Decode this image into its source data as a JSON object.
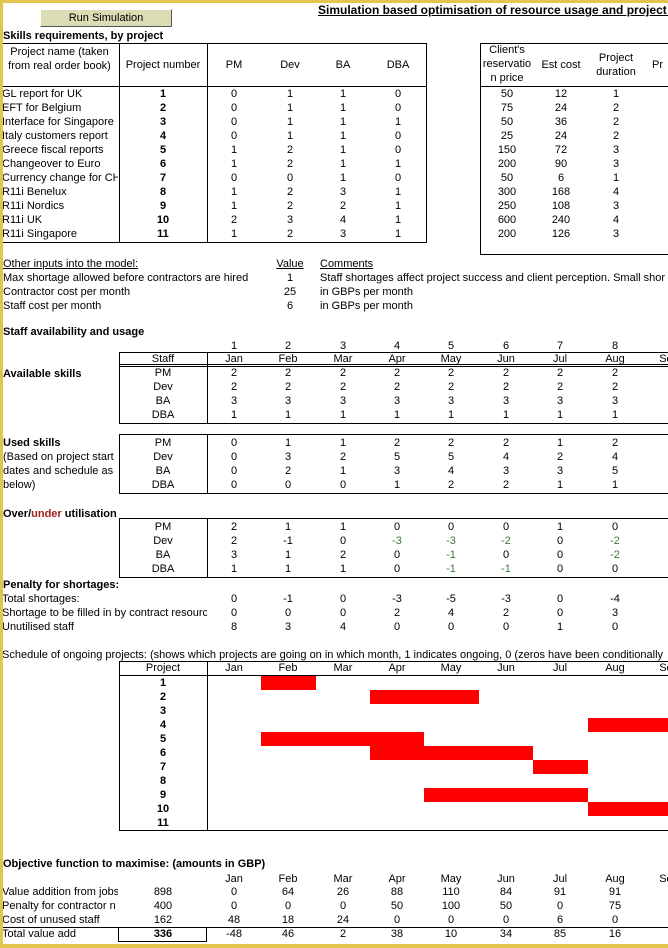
{
  "toolbar": {
    "run_label": "Run Simulation"
  },
  "title": "Simulation based optimisation of resource usage and project p",
  "skills": {
    "heading": "Skills requirements, by project",
    "headers": {
      "name": "Project name (taken from real order book)",
      "number": "Project number",
      "pm": "PM",
      "dev": "Dev",
      "ba": "BA",
      "dba": "DBA",
      "price": "Client's reservatio n price",
      "cost": "Est cost",
      "duration": "Project duration",
      "extra": "Pr"
    },
    "projects": [
      {
        "name": "GL report for UK",
        "number": "1",
        "pm": "0",
        "dev": "1",
        "ba": "1",
        "dba": "0",
        "price": "50",
        "cost": "12",
        "duration": "1"
      },
      {
        "name": "EFT for Belgium",
        "number": "2",
        "pm": "0",
        "dev": "1",
        "ba": "1",
        "dba": "0",
        "price": "75",
        "cost": "24",
        "duration": "2"
      },
      {
        "name": "Interface for Singapore",
        "number": "3",
        "pm": "0",
        "dev": "1",
        "ba": "1",
        "dba": "1",
        "price": "50",
        "cost": "36",
        "duration": "2"
      },
      {
        "name": "Italy customers report",
        "number": "4",
        "pm": "0",
        "dev": "1",
        "ba": "1",
        "dba": "0",
        "price": "25",
        "cost": "24",
        "duration": "2"
      },
      {
        "name": "Greece fiscal reports",
        "number": "5",
        "pm": "1",
        "dev": "2",
        "ba": "1",
        "dba": "0",
        "price": "150",
        "cost": "72",
        "duration": "3"
      },
      {
        "name": "Changeover to Euro",
        "number": "6",
        "pm": "1",
        "dev": "2",
        "ba": "1",
        "dba": "1",
        "price": "200",
        "cost": "90",
        "duration": "3"
      },
      {
        "name": "Currency change for CH",
        "number": "7",
        "pm": "0",
        "dev": "0",
        "ba": "1",
        "dba": "0",
        "price": "50",
        "cost": "6",
        "duration": "1"
      },
      {
        "name": "R11i Benelux",
        "number": "8",
        "pm": "1",
        "dev": "2",
        "ba": "3",
        "dba": "1",
        "price": "300",
        "cost": "168",
        "duration": "4"
      },
      {
        "name": "R11i Nordics",
        "number": "9",
        "pm": "1",
        "dev": "2",
        "ba": "2",
        "dba": "1",
        "price": "250",
        "cost": "108",
        "duration": "3"
      },
      {
        "name": "R11i UK",
        "number": "10",
        "pm": "2",
        "dev": "3",
        "ba": "4",
        "dba": "1",
        "price": "600",
        "cost": "240",
        "duration": "4"
      },
      {
        "name": "R11i Singapore",
        "number": "11",
        "pm": "1",
        "dev": "2",
        "ba": "3",
        "dba": "1",
        "price": "200",
        "cost": "126",
        "duration": "3"
      }
    ]
  },
  "inputs": {
    "heading": "Other inputs into the model:",
    "value_header": "Value",
    "comments_header": "Comments",
    "rows": [
      {
        "label": "Max shortage allowed before contractors are hired",
        "value": "1",
        "comment": "Staff shortages affect project success and client perception. Small shor"
      },
      {
        "label": "Contractor cost per month",
        "value": "25",
        "comment": "in GBPs per month"
      },
      {
        "label": "Staff cost per month",
        "value": "6",
        "comment": "in GBPs per month"
      }
    ]
  },
  "staff": {
    "heading": "Staff availability and usage",
    "month_numbers": [
      "1",
      "2",
      "3",
      "4",
      "5",
      "6",
      "7",
      "8"
    ],
    "staff_header": "Staff",
    "months": [
      "Jan",
      "Feb",
      "Mar",
      "Apr",
      "May",
      "Jun",
      "Jul",
      "Aug",
      "Sep"
    ],
    "available_label": "Available skills",
    "available": [
      {
        "staff": "PM",
        "values": [
          "2",
          "2",
          "2",
          "2",
          "2",
          "2",
          "2",
          "2"
        ]
      },
      {
        "staff": "Dev",
        "values": [
          "2",
          "2",
          "2",
          "2",
          "2",
          "2",
          "2",
          "2"
        ]
      },
      {
        "staff": "BA",
        "values": [
          "3",
          "3",
          "3",
          "3",
          "3",
          "3",
          "3",
          "3"
        ]
      },
      {
        "staff": "DBA",
        "values": [
          "1",
          "1",
          "1",
          "1",
          "1",
          "1",
          "1",
          "1"
        ]
      }
    ],
    "used_label": "Used skills",
    "used_note": [
      "(Based on project start",
      "dates and schedule as",
      "below)"
    ],
    "used": [
      {
        "staff": "PM",
        "values": [
          "0",
          "1",
          "1",
          "2",
          "2",
          "2",
          "1",
          "2"
        ]
      },
      {
        "staff": "Dev",
        "values": [
          "0",
          "3",
          "2",
          "5",
          "5",
          "4",
          "2",
          "4"
        ]
      },
      {
        "staff": "BA",
        "values": [
          "0",
          "2",
          "1",
          "3",
          "4",
          "3",
          "3",
          "5"
        ]
      },
      {
        "staff": "DBA",
        "values": [
          "0",
          "0",
          "0",
          "1",
          "2",
          "2",
          "1",
          "1"
        ]
      }
    ],
    "over_label_a": "Over/",
    "over_label_b": "under",
    "over_label_c": " utilisation",
    "over_under": [
      {
        "staff": "PM",
        "values": [
          "2",
          "1",
          "1",
          "0",
          "0",
          "0",
          "1",
          "0"
        ]
      },
      {
        "staff": "Dev",
        "values": [
          "2",
          "-1",
          "0",
          "-3",
          "-3",
          "-2",
          "0",
          "-2"
        ]
      },
      {
        "staff": "BA",
        "values": [
          "3",
          "1",
          "2",
          "0",
          "-1",
          "0",
          "0",
          "-2"
        ]
      },
      {
        "staff": "DBA",
        "values": [
          "1",
          "1",
          "1",
          "0",
          "-1",
          "-1",
          "0",
          "0"
        ]
      }
    ]
  },
  "penalty": {
    "heading": "Penalty for shortages:",
    "rows": [
      {
        "label": "Total shortages:",
        "values": [
          "0",
          "-1",
          "0",
          "-3",
          "-5",
          "-3",
          "0",
          "-4"
        ]
      },
      {
        "label": "Shortage to be filled in by contract resourc",
        "values": [
          "0",
          "0",
          "0",
          "2",
          "4",
          "2",
          "0",
          "3"
        ]
      },
      {
        "label": "Unutilised staff",
        "values": [
          "8",
          "3",
          "4",
          "0",
          "0",
          "0",
          "1",
          "0"
        ]
      }
    ]
  },
  "schedule": {
    "heading": "Schedule of ongoing projects: (shows which projects are going on in which month, 1 indicates ongoing, 0 (zeros have been conditionally",
    "project_header": "Project",
    "bar_color": "#ff0000",
    "projects": [
      {
        "number": "1",
        "active": [
          0,
          1,
          0,
          0,
          0,
          0,
          0,
          0,
          0
        ]
      },
      {
        "number": "2",
        "active": [
          0,
          0,
          0,
          1,
          1,
          0,
          0,
          0,
          0
        ]
      },
      {
        "number": "3",
        "active": [
          0,
          0,
          0,
          0,
          0,
          0,
          0,
          0,
          0
        ]
      },
      {
        "number": "4",
        "active": [
          0,
          0,
          0,
          0,
          0,
          0,
          0,
          1,
          1
        ]
      },
      {
        "number": "5",
        "active": [
          0,
          1,
          1,
          1,
          0,
          0,
          0,
          0,
          0
        ]
      },
      {
        "number": "6",
        "active": [
          0,
          0,
          0,
          1,
          1,
          1,
          0,
          0,
          0
        ]
      },
      {
        "number": "7",
        "active": [
          0,
          0,
          0,
          0,
          0,
          0,
          1,
          0,
          0
        ]
      },
      {
        "number": "8",
        "active": [
          0,
          0,
          0,
          0,
          0,
          0,
          0,
          0,
          0
        ]
      },
      {
        "number": "9",
        "active": [
          0,
          0,
          0,
          0,
          1,
          1,
          1,
          0,
          0
        ]
      },
      {
        "number": "10",
        "active": [
          0,
          0,
          0,
          0,
          0,
          0,
          0,
          1,
          1
        ]
      },
      {
        "number": "11",
        "active": [
          0,
          0,
          0,
          0,
          0,
          0,
          0,
          0,
          0
        ]
      }
    ]
  },
  "objective": {
    "heading": "Objective function to maximise: (amounts in GBP)",
    "rows": [
      {
        "label": "Value addition from jobs",
        "total": "898",
        "values": [
          "0",
          "64",
          "26",
          "88",
          "110",
          "84",
          "91",
          "91"
        ]
      },
      {
        "label": "Penalty for contractor n",
        "total": "400",
        "values": [
          "0",
          "0",
          "0",
          "50",
          "100",
          "50",
          "0",
          "75"
        ]
      },
      {
        "label": "Cost of unused staff",
        "total": "162",
        "values": [
          "48",
          "18",
          "24",
          "0",
          "0",
          "0",
          "6",
          "0"
        ]
      },
      {
        "label": "Total value add",
        "total": "336",
        "values": [
          "-48",
          "46",
          "2",
          "38",
          "10",
          "34",
          "85",
          "16"
        ]
      }
    ]
  }
}
